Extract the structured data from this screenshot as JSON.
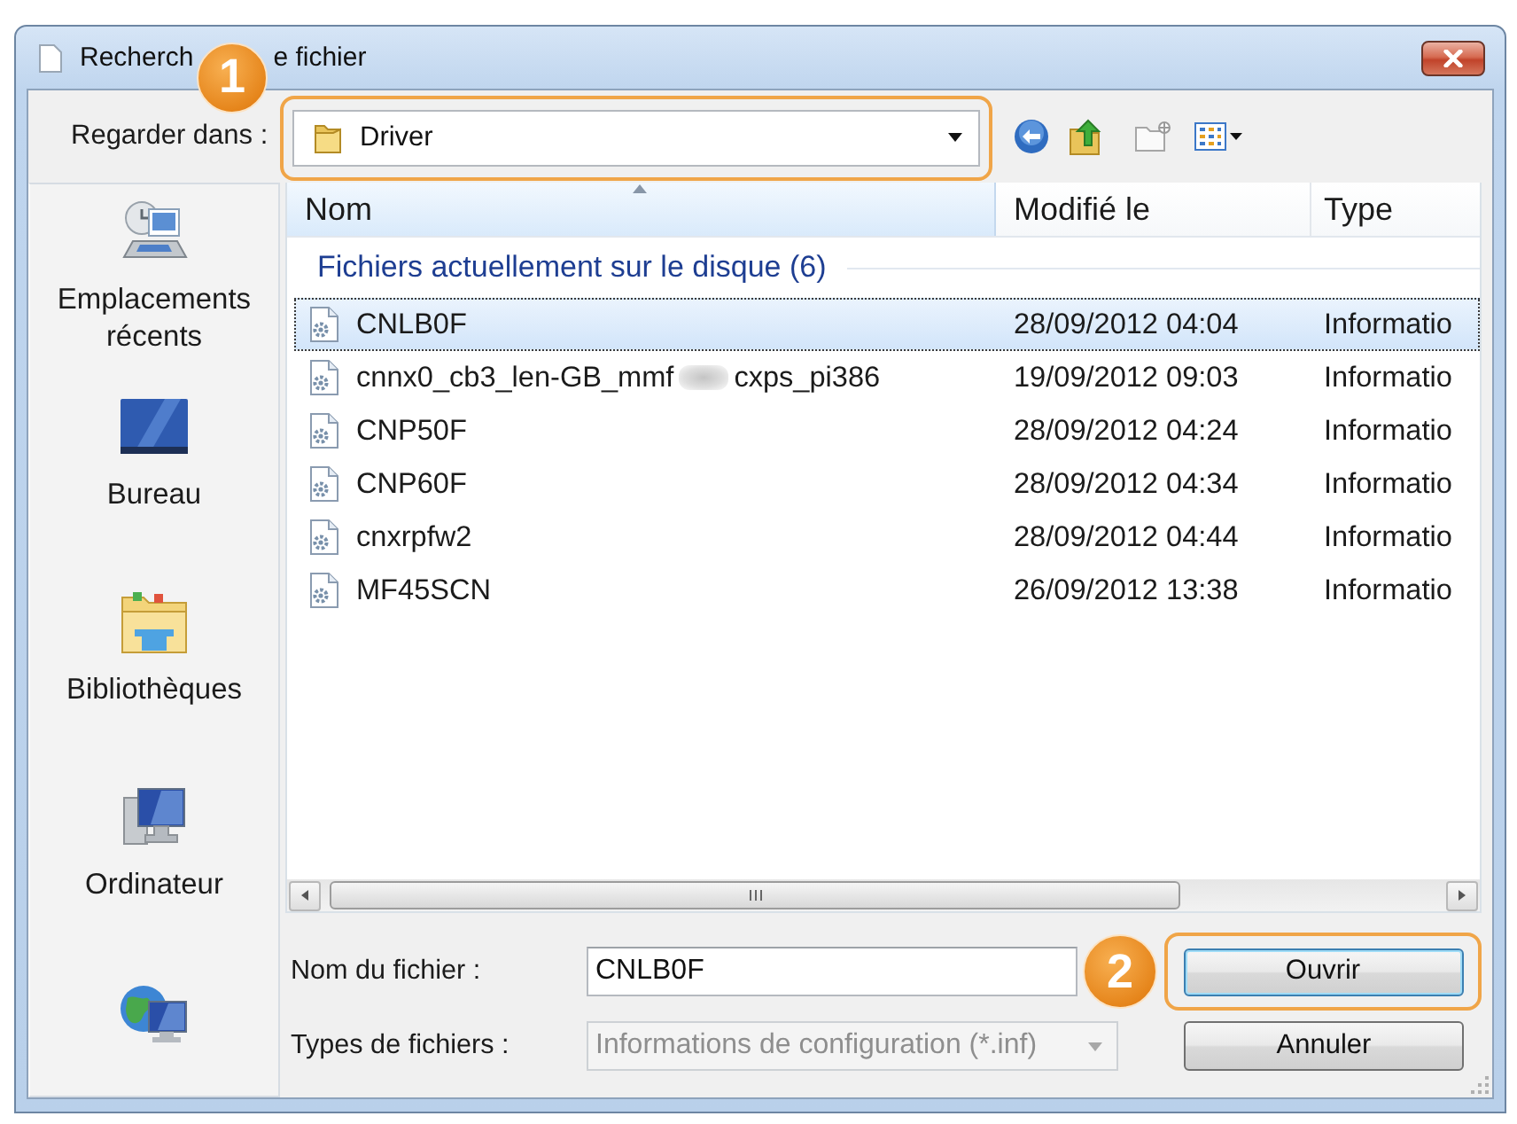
{
  "window": {
    "title_parts": [
      "Recherch",
      "e fichier"
    ]
  },
  "look_in": {
    "label": "Regarder dans :",
    "value": "Driver",
    "callout": "1"
  },
  "places": [
    {
      "label": "Emplacements récents",
      "kind": "recent"
    },
    {
      "label": "Bureau",
      "kind": "desktop"
    },
    {
      "label": "Bibliothèques",
      "kind": "libraries"
    },
    {
      "label": "Ordinateur",
      "kind": "computer"
    },
    {
      "kind": "network"
    }
  ],
  "file_list": {
    "columns": [
      {
        "label": "Nom",
        "sorted": true
      },
      {
        "label": "Modifié le",
        "sorted": false
      },
      {
        "label": "Type",
        "sorted": false
      }
    ],
    "group": "Fichiers actuellement sur le disque (6)",
    "rows": [
      {
        "name": "CNLB0F",
        "modified": "28/09/2012 04:04",
        "type": "Informatio",
        "selected": true
      },
      {
        "name": "cnnx0_cb3_len-GB_mmf",
        "redacted": true,
        "name_rest": "cxps_pi386",
        "modified": "19/09/2012 09:03",
        "type": "Informatio",
        "selected": false
      },
      {
        "name": "CNP50F",
        "modified": "28/09/2012 04:24",
        "type": "Informatio",
        "selected": false
      },
      {
        "name": "CNP60F",
        "modified": "28/09/2012 04:34",
        "type": "Informatio",
        "selected": false
      },
      {
        "name": "cnxrpfw2",
        "modified": "28/09/2012 04:44",
        "type": "Informatio",
        "selected": false
      },
      {
        "name": "MF45SCN",
        "modified": "26/09/2012 13:38",
        "type": "Informatio",
        "selected": false
      }
    ]
  },
  "file_name": {
    "label": "Nom du fichier :",
    "value": "CNLB0F"
  },
  "file_type": {
    "label": "Types de fichiers :",
    "value": "Informations de configuration (*.inf)",
    "disabled": true
  },
  "buttons": [
    {
      "label": "Ouvrir",
      "default": true,
      "callout": "2"
    },
    {
      "label": "Annuler",
      "default": false
    }
  ]
}
